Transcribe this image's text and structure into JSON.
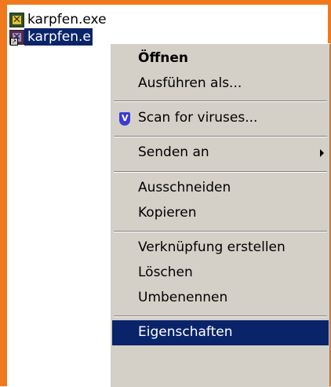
{
  "files": [
    {
      "name": "karpfen.exe",
      "selected": false
    },
    {
      "name": "karpfen.e",
      "selected": true
    }
  ],
  "context_menu": {
    "items": [
      {
        "label": "Öffnen"
      },
      {
        "label": "Ausführen als..."
      },
      {
        "label": "Scan for viruses...",
        "icon": "antivirus-shield-icon"
      },
      {
        "label": "Senden an",
        "submenu": true
      },
      {
        "label": "Ausschneiden"
      },
      {
        "label": "Kopieren"
      },
      {
        "label": "Verknüpfung erstellen"
      },
      {
        "label": "Löschen"
      },
      {
        "label": "Umbenennen"
      },
      {
        "label": "Eigenschaften",
        "highlighted": true
      }
    ]
  },
  "colors": {
    "frame": "#f0791e",
    "menu_bg": "#d4d0c8",
    "selection": "#0a246a"
  }
}
